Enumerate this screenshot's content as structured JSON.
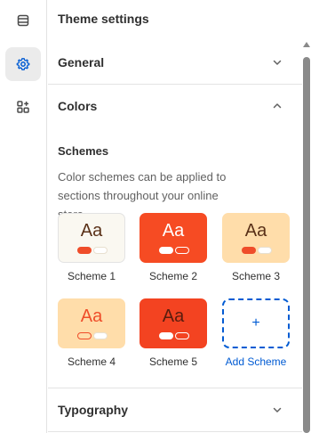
{
  "sidebar": {
    "items": [
      {
        "icon": "sections-icon",
        "active": false
      },
      {
        "icon": "gear-icon",
        "active": true
      },
      {
        "icon": "apps-icon",
        "active": false
      }
    ]
  },
  "panel": {
    "title": "Theme settings",
    "sections": {
      "general": {
        "label": "General",
        "expanded": false
      },
      "colors": {
        "label": "Colors",
        "expanded": true
      },
      "typography": {
        "label": "Typography",
        "expanded": false
      }
    }
  },
  "colors": {
    "schemes_heading": "Schemes",
    "schemes_description": "Color schemes can be applied to sections throughout your online store.",
    "sample_text": "Aa",
    "schemes": [
      {
        "name": "Scheme 1",
        "background": "#faf8f1",
        "text": "#5a3118",
        "pill1": "#ef4d2a",
        "pill2": "#ffffff"
      },
      {
        "name": "Scheme 2",
        "background": "#f64b23",
        "text": "#ffffff",
        "pill1": "#ffffff",
        "pill2": "#f64b23"
      },
      {
        "name": "Scheme 3",
        "background": "#ffddaa",
        "text": "#5a3118",
        "pill1": "#ef4d2a",
        "pill2": "#ffffff"
      },
      {
        "name": "Scheme 4",
        "background": "#ffddaa",
        "text": "#ef4d2a",
        "pill1": "#ffddaa",
        "pill2": "#ffffff"
      },
      {
        "name": "Scheme 5",
        "background": "#f34321",
        "text": "#5a1d0e",
        "pill1": "#ffffff",
        "pill2": "#f34321"
      }
    ],
    "add_scheme": {
      "label": "Add Scheme",
      "icon_text": "+"
    }
  },
  "accent_color": "#005bd3"
}
